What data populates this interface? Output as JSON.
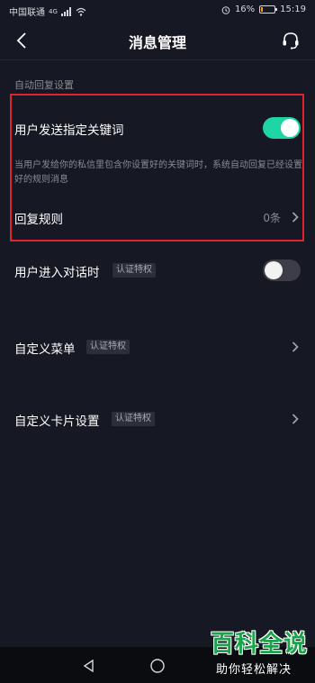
{
  "status_bar": {
    "carrier": "中国联通",
    "network": "4G",
    "battery_text": "16%",
    "time": "15:19",
    "battery_level": 0.16
  },
  "nav": {
    "title": "消息管理",
    "back_icon": "back-chevron-icon",
    "support_icon": "headset-icon"
  },
  "auto_reply": {
    "section_title": "自动回复设置",
    "keyword_label": "用户发送指定关键词",
    "keyword_enabled": true,
    "description": "当用户发给你的私信里包含你设置好的关键词时，系统自动回复已经设置好的规则消息",
    "rules_label": "回复规则",
    "rules_count": "0条"
  },
  "items": [
    {
      "label": "用户进入对话时",
      "badge": "认证特权",
      "control": "toggle",
      "enabled": false
    },
    {
      "label": "自定义菜单",
      "badge": "认证特权",
      "control": "chevron"
    },
    {
      "label": "自定义卡片设置",
      "badge": "认证特权",
      "control": "chevron"
    }
  ],
  "watermark": {
    "main": "百科全说",
    "sub": "助你轻松解决"
  },
  "colors": {
    "background": "#161823",
    "toggle_on": "#20d5a5",
    "highlight": "#e0242f"
  }
}
